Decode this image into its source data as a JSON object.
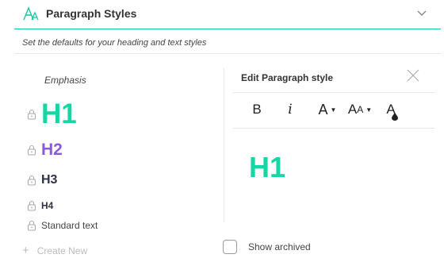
{
  "header": {
    "title": "Paragraph Styles",
    "accent_color": "#17c5a0"
  },
  "subtitle": "Set the defaults for your heading and text styles",
  "style_list": {
    "items": [
      {
        "label": "Emphasis",
        "locked": false
      },
      {
        "label": "H1",
        "locked": true,
        "color": "#17d6a3"
      },
      {
        "label": "H2",
        "locked": true,
        "color": "#8a5bd6"
      },
      {
        "label": "H3",
        "locked": true,
        "color": "#2f3144"
      },
      {
        "label": "H4",
        "locked": true,
        "color": "#2f3144"
      },
      {
        "label": "Standard text",
        "locked": true
      }
    ]
  },
  "editor": {
    "title": "Edit Paragraph style",
    "toolbar": {
      "bold": "B",
      "italic": "i",
      "font_size": "A",
      "text_case_large": "A",
      "text_case_small": "A",
      "text_color": "A"
    },
    "preview_text": "H1",
    "preview_color": "#17d6a3"
  },
  "footer": {
    "create_new": "Create New",
    "show_archived": "Show archived",
    "show_archived_checked": false
  }
}
